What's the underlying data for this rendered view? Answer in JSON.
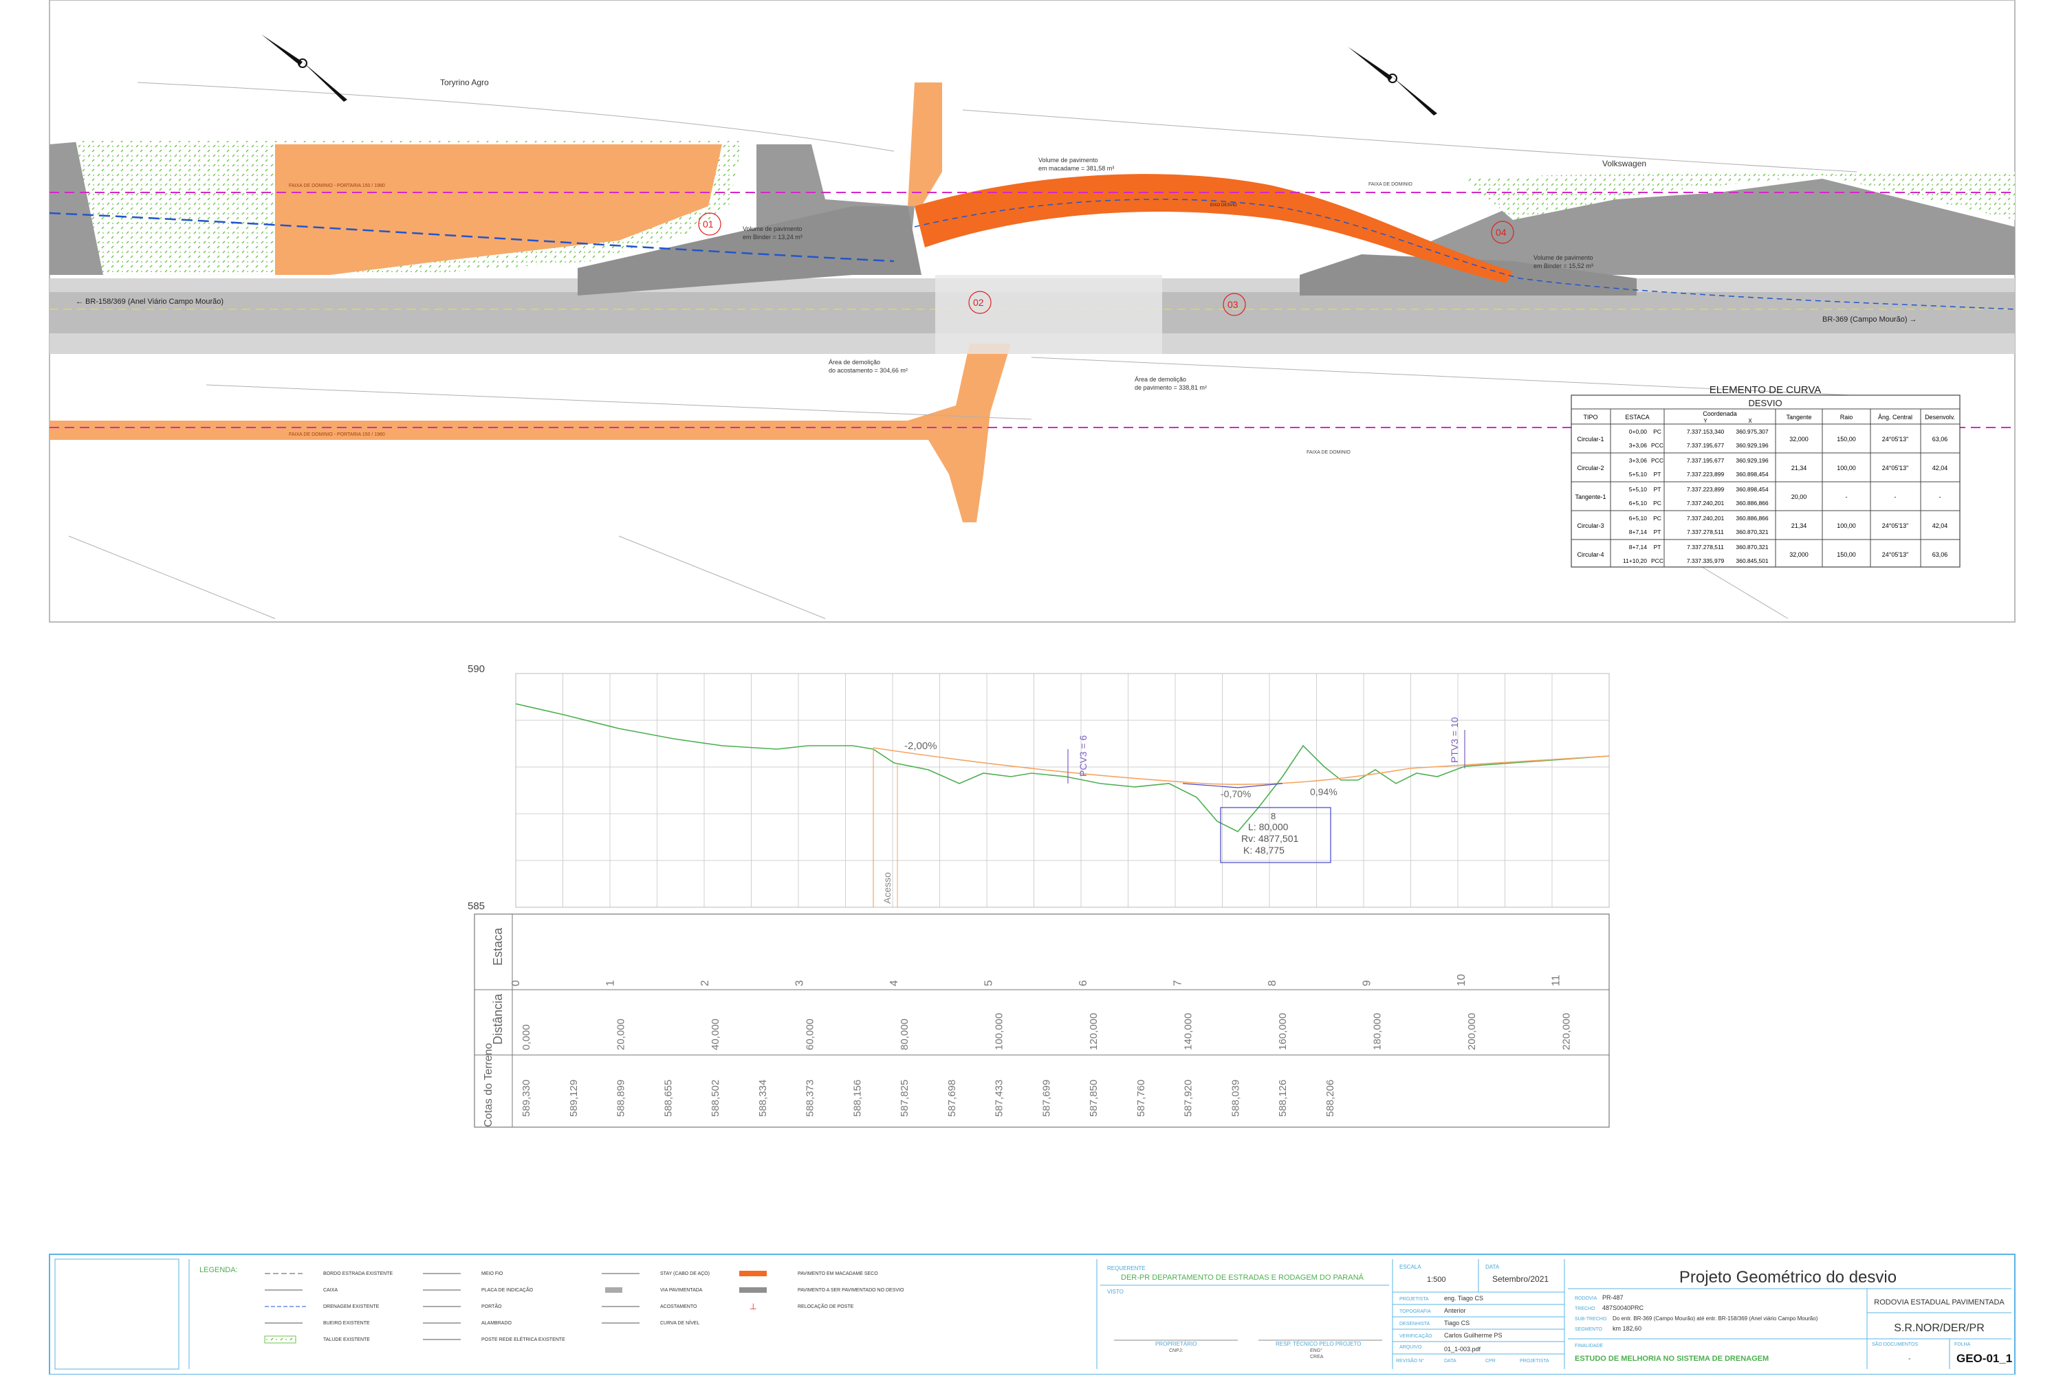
{
  "plan": {
    "label_torrino": "Toryrino Agro",
    "label_volkswagen": "Volkswagen",
    "road_left": "← BR-158/369 (Anel Viário Campo Mourão)",
    "road_right": "BR-369 (Campo Mourão) →",
    "faixa_top": "FAIXA DE DOMINIO - PORTARIA 150 / 1980",
    "faixa_bottom": "FAIXA DE DOMINIO - PORTARIA 150 / 1980",
    "faixa_small_1": "FAIXA DE DOMINIO",
    "faixa_small_2": "FAIXA DE DOMINIO",
    "ann_macadame_1": "Volume de pavimento",
    "ann_macadame_2": "em macadame = 381,58 m³",
    "ann_binder1_1": "Volume de pavimento",
    "ann_binder1_2": "em Binder = 13,24 m³",
    "ann_binder2_1": "Volume de pavimento",
    "ann_binder2_2": "em Binder = 15,52 m³",
    "ann_acost_1": "Área de demolição",
    "ann_acost_2": "do acostamento = 304,66 m²",
    "ann_pav_1": "Área de demolição",
    "ann_pav_2": "de pavimento = 338,81 m²",
    "zone_labels": [
      "01",
      "02",
      "03",
      "04"
    ],
    "eixo_label": "EIXO DESVIO"
  },
  "curve_table": {
    "title": "ELEMENTO DE CURVA",
    "subtitle": "DESVIO",
    "headers": [
      "TIPO",
      "ESTACA",
      "Coordenada",
      "Tangente",
      "Raio",
      "Âng. Central",
      "Desenvolv."
    ],
    "coord_sub": [
      "Y",
      "X"
    ],
    "rows": [
      {
        "tipo": "Circular-1",
        "estacas": [
          "0+0,00",
          "3+3,06"
        ],
        "marks": [
          "PC",
          "PCC"
        ],
        "y": [
          "7.337.153,340",
          "7.337.195,677"
        ],
        "x": [
          "360.975,307",
          "360.929,196"
        ],
        "tangente": "32,000",
        "raio": "150,00",
        "ang": "24°05'13\"",
        "desenv": "63,06"
      },
      {
        "tipo": "Circular-2",
        "estacas": [
          "3+3,06",
          "5+5,10"
        ],
        "marks": [
          "PCC",
          "PT"
        ],
        "y": [
          "7.337.195,677",
          "7.337.223,899"
        ],
        "x": [
          "360.929,196",
          "360.898,454"
        ],
        "tangente": "21,34",
        "raio": "100,00",
        "ang": "24°05'13\"",
        "desenv": "42,04"
      },
      {
        "tipo": "Tangente-1",
        "estacas": [
          "5+5,10",
          "6+5,10"
        ],
        "marks": [
          "PT",
          "PC"
        ],
        "y": [
          "7.337.223,899",
          "7.337.240,201"
        ],
        "x": [
          "360.898,454",
          "360.886,866"
        ],
        "tangente": "20,00",
        "raio": "-",
        "ang": "-",
        "desenv": "-"
      },
      {
        "tipo": "Circular-3",
        "estacas": [
          "6+5,10",
          "8+7,14"
        ],
        "marks": [
          "PC",
          "PT"
        ],
        "y": [
          "7.337.240,201",
          "7.337.278,511"
        ],
        "x": [
          "360.886,866",
          "360.870,321"
        ],
        "tangente": "21,34",
        "raio": "100,00",
        "ang": "24°05'13\"",
        "desenv": "42,04"
      },
      {
        "tipo": "Circular-4",
        "estacas": [
          "8+7,14",
          "11+10,20"
        ],
        "marks": [
          "PT",
          "PCC"
        ],
        "y": [
          "7.337.278,511",
          "7.337.335,979"
        ],
        "x": [
          "360.870,321",
          "360.845,501"
        ],
        "tangente": "32,000",
        "raio": "150,00",
        "ang": "24°05'13\"",
        "desenv": "63,06"
      }
    ]
  },
  "profile": {
    "y_top": "590",
    "y_bottom": "585",
    "grade_1": "-2,00%",
    "grade_2": "-0,70%",
    "grade_3": "0,94%",
    "pcv": "PCV3 = 6",
    "ptv": "PTV3 = 10",
    "acesso": "Acesso",
    "box_id": "8",
    "box_l": "L: 80,000",
    "box_rv": "Rv: 4877,501",
    "box_k": "K: 48,775",
    "row_labels": [
      "Estaca",
      "Distância",
      "Cotas do Terreno"
    ],
    "estacas": [
      "0",
      "1",
      "2",
      "3",
      "4",
      "5",
      "6",
      "7",
      "8",
      "9",
      "10",
      "11"
    ],
    "distancias": [
      "0,000",
      "20,000",
      "40,000",
      "60,000",
      "80,000",
      "100,000",
      "120,000",
      "140,000",
      "160,000",
      "180,000",
      "200,000",
      "220,000"
    ],
    "cotas": [
      "589,330",
      "589,129",
      "588,899",
      "588,655",
      "588,502",
      "588,334",
      "588,373",
      "588,156",
      "587,825",
      "587,698",
      "587,433",
      "587,699",
      "587,850",
      "587,760",
      "587,920",
      "588,039",
      "588,126",
      "588,206"
    ]
  },
  "legend": {
    "title": "LEGENDA:",
    "items_col1": [
      "BORDO ESTRADA EXISTENTE",
      "CAIXA",
      "DRENAGEM EXISTENTE",
      "BUEIRO EXISTENTE",
      "TALUDE EXISTENTE"
    ],
    "items_col2": [
      "MEIO FIO",
      "PLACA DE INDICAÇÃO",
      "PORTÃO",
      "ALAMBRADO",
      "POSTE REDE ELÉTRICA EXISTENTE"
    ],
    "items_col3": [
      "STAY (CABO DE AÇO)",
      "VIA PAVIMENTADA",
      "ACOSTAMENTO",
      "CURVA DE NÍVEL"
    ],
    "items_col4": [
      "PAVIMENTO EM MACADAME SECO",
      "PAVIMENTO A SER PAVIMENTADO NO DESVIO",
      "RELOCAÇÃO DE POSTE"
    ]
  },
  "titleblock": {
    "requerente_lbl": "REQUERENTE",
    "requerente": "DER-PR DEPARTAMENTO DE ESTRADAS E RODAGEM DO PARANÁ",
    "visto_lbl": "VISTO",
    "proprietario_lbl": "PROPRIETÁRIO",
    "proprietario_doc": "CNPJ:",
    "resp_lbl": "RESP. TÉCNICO PELO PROJETO",
    "resp_doc1": "ENG°",
    "resp_doc2": "CREA",
    "escala_lbl": "ESCALA",
    "escala": "1:500",
    "data_lbl": "DATA",
    "data": "Setembro/2021",
    "projetista_lbl": "PROJETISTA",
    "projetista": "eng. Tiago CS",
    "topografia_lbl": "TOPOGRAFIA",
    "topografia": "Anterior",
    "desenhista_lbl": "DESENHISTA",
    "desenhista": "Tiago CS",
    "verificacao_lbl": "VERIFICAÇÃO",
    "verificacao": "Carlos Guilherme PS",
    "arquivo_lbl": "ARQUIVO",
    "arquivo": "01_1-003.pdf",
    "revisoes": [
      "REVISÃO N°",
      "DATA",
      "CPR",
      "PROJETISTA"
    ],
    "project_title": "Projeto Geométrico do desvio",
    "rodovia_lbl": "RODOVIA",
    "rodovia": "PR-487",
    "trecho_lbl": "TRECHO",
    "trecho": "487S0040PRC",
    "subtrecho_lbl": "SUB-TRECHO",
    "subtrecho": "Do entr. BR-369 (Campo Mourão) até entr. BR-158/369 (Anel viário Campo Mourão)",
    "segmento_lbl": "SEGMENTO",
    "segmento": "km 182,60",
    "finalidade_lbl": "FINALIDADE",
    "finalidade": "ESTUDO DE MELHORIA NO SISTEMA DE DRENAGEM",
    "right_title": "RODOVIA ESTADUAL PAVIMENTADA",
    "orgao": "S.R.NOR/DER/PR",
    "doc_lbl": "SÃO DOCUMENTOS",
    "doc_val": "-",
    "folha_lbl": "FOLHA",
    "folha": "GEO-01_1"
  },
  "colors": {
    "orange_dark": "#f26b21",
    "orange_light": "#f7a96a",
    "gray_dark": "#8f8f8f",
    "gray_light": "#c9c9c9",
    "green_hatch": "#6cc24a",
    "magenta": "#d428c8",
    "blue": "#2255cc",
    "profile_green": "#4caf50",
    "profile_orange": "#f4a460"
  }
}
